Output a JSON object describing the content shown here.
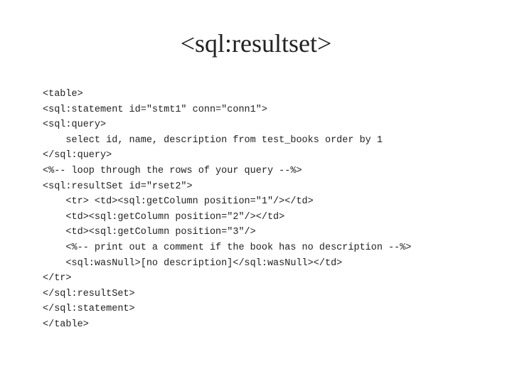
{
  "title": "<sql:resultset>",
  "code": {
    "lines": [
      "<table>",
      "<sql:statement id=\"stmt1\" conn=\"conn1\">",
      "<sql:query>",
      "    select id, name, description from test_books order by 1",
      "</sql:query>",
      "<%-- loop through the rows of your query --%>",
      "<sql:resultSet id=\"rset2\">",
      "    <tr> <td><sql:getColumn position=\"1\"/></td>",
      "    <td><sql:getColumn position=\"2\"/></td>",
      "    <td><sql:getColumn position=\"3\"/>",
      "    <%-- print out a comment if the book has no description --%>",
      "    <sql:wasNull>[no description]</sql:wasNull></td>",
      "</tr>",
      "</sql:resultSet>",
      "</sql:statement>",
      "</table>"
    ]
  }
}
